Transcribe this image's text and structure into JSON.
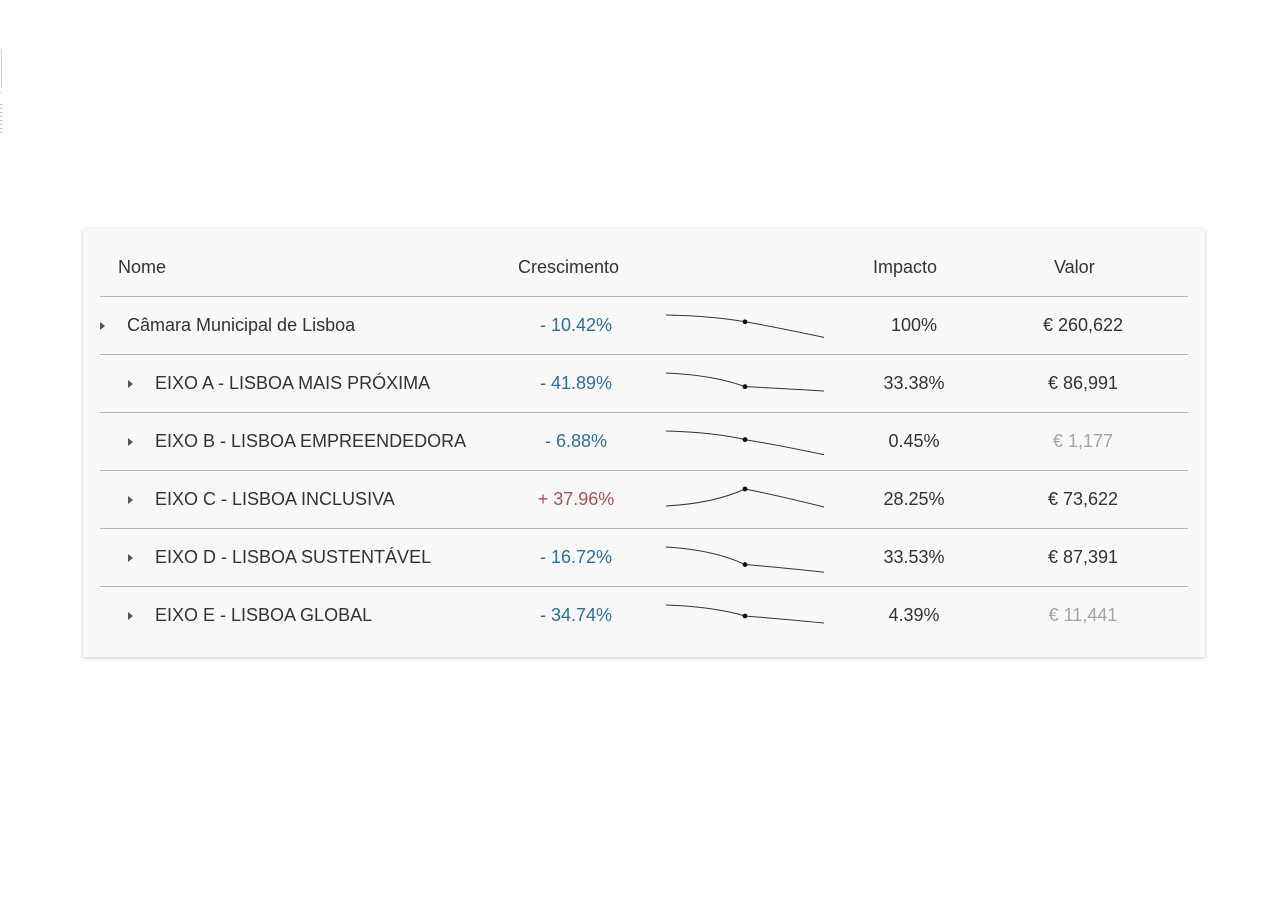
{
  "table": {
    "headers": {
      "name": "Nome",
      "growth": "Crescimento",
      "impact": "Impacto",
      "value": "Valor"
    },
    "rows": [
      {
        "name": "Câmara Municipal de Lisboa",
        "level": 0,
        "growth": "- 10.42%",
        "growth_sign": "negative",
        "impact": "100%",
        "value": "€ 260,622",
        "value_dimmed": false,
        "spark": [
          1.0,
          0.9558,
          0.8543
        ]
      },
      {
        "name": "EIXO A - LISBOA MAIS PRÓXIMA",
        "level": 1,
        "growth": "- 41.89%",
        "growth_sign": "negative",
        "impact": "33.38%",
        "value": "€ 86,991",
        "value_dimmed": false,
        "spark": [
          1.0,
          0.5811,
          0.4466
        ]
      },
      {
        "name": "EIXO B - LISBOA EMPREENDEDORA",
        "level": 1,
        "growth": "- 6.88%",
        "growth_sign": "negative",
        "impact": "0.45%",
        "value": "€ 1,177",
        "value_dimmed": true,
        "spark": [
          1.0,
          0.9312,
          0.81
        ]
      },
      {
        "name": "EIXO C - LISBOA INCLUSIVA",
        "level": 1,
        "growth": "+ 37.96%",
        "growth_sign": "positive",
        "impact": "28.25%",
        "value": "€ 73,622",
        "value_dimmed": false,
        "spark": [
          0.5,
          1.0,
          0.47
        ]
      },
      {
        "name": "EIXO D - LISBOA SUSTENTÁVEL",
        "level": 1,
        "growth": "- 16.72%",
        "growth_sign": "negative",
        "impact": "33.53%",
        "value": "€ 87,391",
        "value_dimmed": false,
        "spark": [
          1.0,
          0.8328,
          0.76
        ]
      },
      {
        "name": "EIXO E - LISBOA GLOBAL",
        "level": 1,
        "growth": "- 34.74%",
        "growth_sign": "negative",
        "impact": "4.39%",
        "value": "€ 11,441",
        "value_dimmed": true,
        "spark": [
          1.0,
          0.6526,
          0.43
        ]
      }
    ]
  },
  "colors": {
    "negative": "#2f6f97",
    "positive": "#a3545b",
    "dimmed": "#a5a5a5",
    "sparkline": "#333333"
  },
  "icons": {
    "expand": "caret-right-icon"
  }
}
